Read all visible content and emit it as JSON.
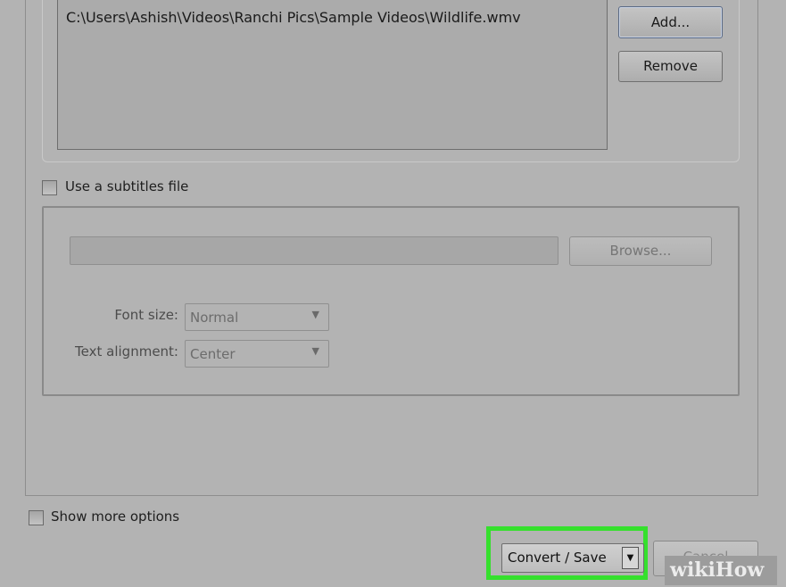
{
  "files": {
    "entries": [
      "C:\\Users\\Ashish\\Videos\\Ranchi Pics\\Sample Videos\\Wildlife.wmv"
    ],
    "add_label": "Add...",
    "remove_label": "Remove"
  },
  "subtitles": {
    "checkbox_label": "Use a subtitles file",
    "checked": false,
    "path_value": "",
    "browse_label": "Browse...",
    "font_size_label": "Font size:",
    "font_size_value": "Normal",
    "alignment_label": "Text alignment:",
    "alignment_value": "Center"
  },
  "options": {
    "show_more_label": "Show more options",
    "checked": false
  },
  "footer": {
    "convert_label": "Convert / Save",
    "cancel_label": "Cancel"
  },
  "watermark": {
    "part1": "wiki",
    "part2": "How"
  },
  "colors": {
    "highlight": "#35e02d",
    "background": "#b3b3b3"
  },
  "icons": {
    "dropdown": "chevron-down-icon",
    "split_arrow": "caret-down-icon"
  }
}
